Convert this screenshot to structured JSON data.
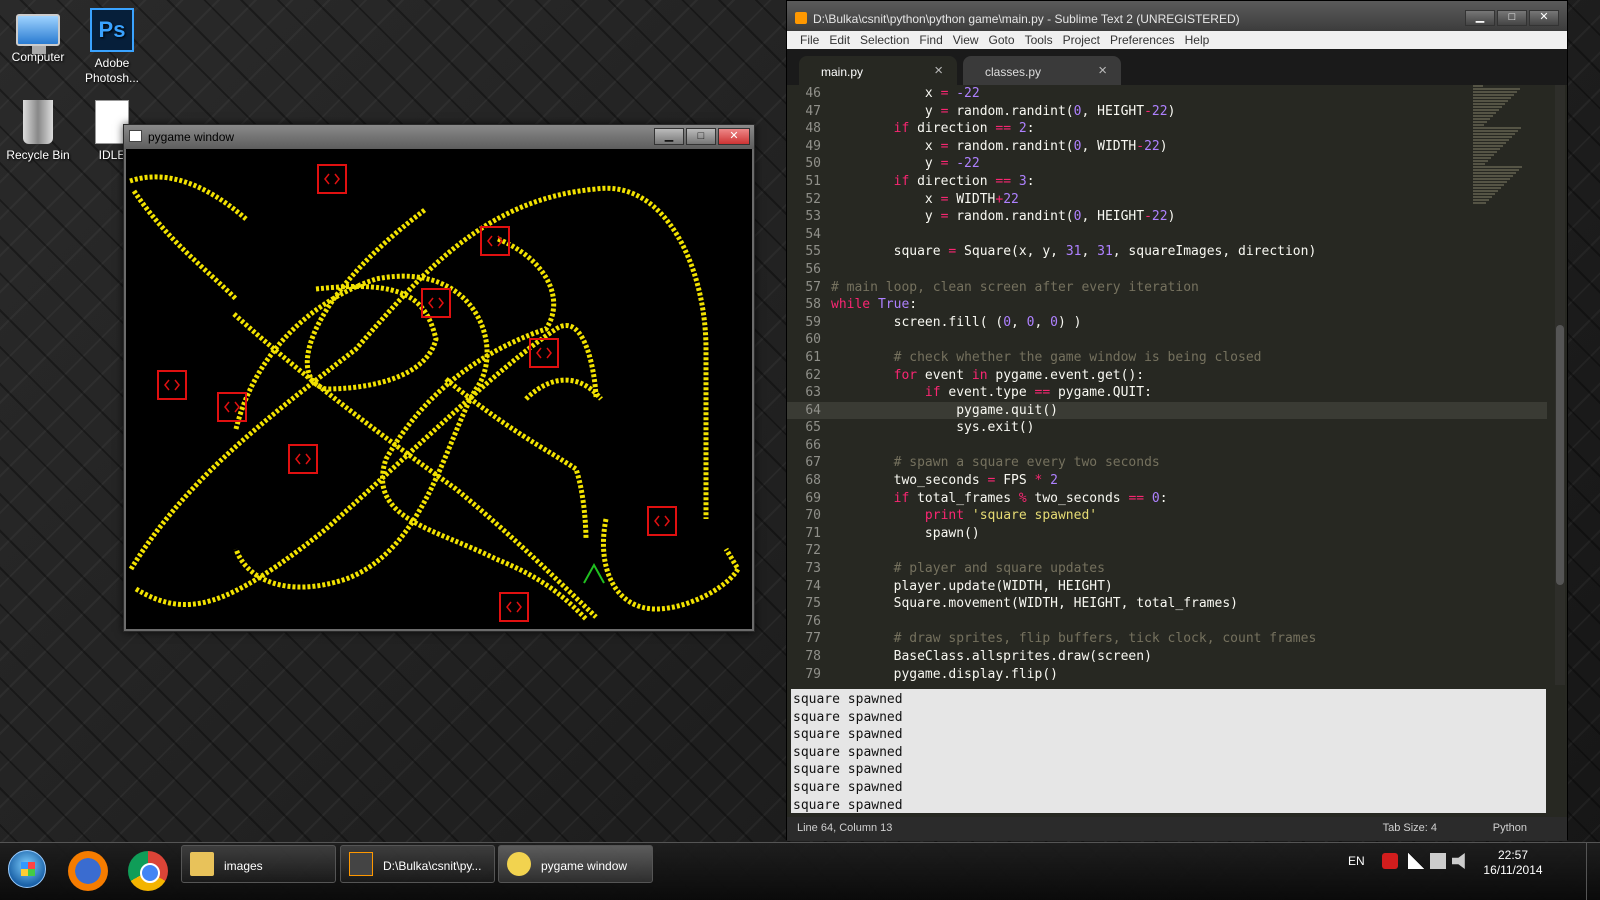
{
  "desktop_icons": [
    {
      "name": "computer",
      "label": "Computer"
    },
    {
      "name": "photoshop",
      "label": "Adobe Photosh..."
    },
    {
      "name": "recycle-bin",
      "label": "Recycle Bin"
    },
    {
      "name": "idle",
      "label": "IDLE"
    }
  ],
  "pygame_window": {
    "title": "pygame window",
    "buttons": {
      "minimize": "▁",
      "maximize": "□",
      "close": "✕"
    },
    "colors": {
      "background": "#000000",
      "trail": "#f2e200",
      "square": "#e01010",
      "player": "#20c020"
    }
  },
  "sublime": {
    "title": "D:\\Bulka\\csnit\\python\\python game\\main.py - Sublime Text 2 (UNREGISTERED)",
    "buttons": {
      "minimize": "▁",
      "maximize": "□",
      "close": "✕"
    },
    "menu": [
      "File",
      "Edit",
      "Selection",
      "Find",
      "View",
      "Goto",
      "Tools",
      "Project",
      "Preferences",
      "Help"
    ],
    "tabs": [
      {
        "label": "main.py",
        "active": true,
        "close": "×"
      },
      {
        "label": "classes.py",
        "active": false,
        "close": "×"
      }
    ],
    "current_line": 64,
    "code_lines": [
      {
        "n": 46,
        "tokens": [
          [
            "            x ",
            "code"
          ],
          [
            "=",
            "op"
          ],
          [
            " ",
            "code"
          ],
          [
            "-22",
            "num"
          ]
        ]
      },
      {
        "n": 47,
        "tokens": [
          [
            "            y ",
            "code"
          ],
          [
            "=",
            "op"
          ],
          [
            " random.randint(",
            "code"
          ],
          [
            "0",
            "num"
          ],
          [
            ", HEIGHT",
            "code"
          ],
          [
            "-",
            "op"
          ],
          [
            "22",
            "num"
          ],
          [
            ")",
            "code"
          ]
        ]
      },
      {
        "n": 48,
        "tokens": [
          [
            "        ",
            "code"
          ],
          [
            "if",
            "kw"
          ],
          [
            " direction ",
            "code"
          ],
          [
            "==",
            "op"
          ],
          [
            " ",
            "code"
          ],
          [
            "2",
            "num"
          ],
          [
            ":",
            "code"
          ]
        ]
      },
      {
        "n": 49,
        "tokens": [
          [
            "            x ",
            "code"
          ],
          [
            "=",
            "op"
          ],
          [
            " random.randint(",
            "code"
          ],
          [
            "0",
            "num"
          ],
          [
            ", WIDTH",
            "code"
          ],
          [
            "-",
            "op"
          ],
          [
            "22",
            "num"
          ],
          [
            ")",
            "code"
          ]
        ]
      },
      {
        "n": 50,
        "tokens": [
          [
            "            y ",
            "code"
          ],
          [
            "=",
            "op"
          ],
          [
            " ",
            "code"
          ],
          [
            "-22",
            "num"
          ]
        ]
      },
      {
        "n": 51,
        "tokens": [
          [
            "        ",
            "code"
          ],
          [
            "if",
            "kw"
          ],
          [
            " direction ",
            "code"
          ],
          [
            "==",
            "op"
          ],
          [
            " ",
            "code"
          ],
          [
            "3",
            "num"
          ],
          [
            ":",
            "code"
          ]
        ]
      },
      {
        "n": 52,
        "tokens": [
          [
            "            x ",
            "code"
          ],
          [
            "=",
            "op"
          ],
          [
            " WIDTH",
            "code"
          ],
          [
            "+",
            "op"
          ],
          [
            "22",
            "num"
          ]
        ]
      },
      {
        "n": 53,
        "tokens": [
          [
            "            y ",
            "code"
          ],
          [
            "=",
            "op"
          ],
          [
            " random.randint(",
            "code"
          ],
          [
            "0",
            "num"
          ],
          [
            ", HEIGHT",
            "code"
          ],
          [
            "-",
            "op"
          ],
          [
            "22",
            "num"
          ],
          [
            ")",
            "code"
          ]
        ]
      },
      {
        "n": 54,
        "tokens": []
      },
      {
        "n": 55,
        "tokens": [
          [
            "        square ",
            "code"
          ],
          [
            "=",
            "op"
          ],
          [
            " Square(x, y, ",
            "code"
          ],
          [
            "31",
            "num"
          ],
          [
            ", ",
            "code"
          ],
          [
            "31",
            "num"
          ],
          [
            ", squareImages, direction)",
            "code"
          ]
        ]
      },
      {
        "n": 56,
        "tokens": []
      },
      {
        "n": 57,
        "tokens": [
          [
            "# main loop, clean screen after every iteration",
            "cmt"
          ]
        ]
      },
      {
        "n": 58,
        "tokens": [
          [
            "while",
            "kw"
          ],
          [
            " ",
            "code"
          ],
          [
            "True",
            "num"
          ],
          [
            ":",
            "code"
          ]
        ]
      },
      {
        "n": 59,
        "tokens": [
          [
            "        screen.fill( (",
            "code"
          ],
          [
            "0",
            "num"
          ],
          [
            ", ",
            "code"
          ],
          [
            "0",
            "num"
          ],
          [
            ", ",
            "code"
          ],
          [
            "0",
            "num"
          ],
          [
            ") )",
            "code"
          ]
        ]
      },
      {
        "n": 60,
        "tokens": []
      },
      {
        "n": 61,
        "tokens": [
          [
            "        ",
            "code"
          ],
          [
            "# check whether the game window is being closed",
            "cmt"
          ]
        ]
      },
      {
        "n": 62,
        "tokens": [
          [
            "        ",
            "code"
          ],
          [
            "for",
            "kw"
          ],
          [
            " event ",
            "code"
          ],
          [
            "in",
            "kw"
          ],
          [
            " pygame.event.get():",
            "code"
          ]
        ]
      },
      {
        "n": 63,
        "tokens": [
          [
            "            ",
            "code"
          ],
          [
            "if",
            "kw"
          ],
          [
            " event.type ",
            "code"
          ],
          [
            "==",
            "op"
          ],
          [
            " pygame.QUIT:",
            "code"
          ]
        ]
      },
      {
        "n": 64,
        "tokens": [
          [
            "                pygame.quit()",
            "code"
          ]
        ]
      },
      {
        "n": 65,
        "tokens": [
          [
            "                sys.exit()",
            "code"
          ]
        ]
      },
      {
        "n": 66,
        "tokens": []
      },
      {
        "n": 67,
        "tokens": [
          [
            "        ",
            "code"
          ],
          [
            "# spawn a square every two seconds",
            "cmt"
          ]
        ]
      },
      {
        "n": 68,
        "tokens": [
          [
            "        two_seconds ",
            "code"
          ],
          [
            "=",
            "op"
          ],
          [
            " FPS ",
            "code"
          ],
          [
            "*",
            "op"
          ],
          [
            " ",
            "code"
          ],
          [
            "2",
            "num"
          ]
        ]
      },
      {
        "n": 69,
        "tokens": [
          [
            "        ",
            "code"
          ],
          [
            "if",
            "kw"
          ],
          [
            " total_frames ",
            "code"
          ],
          [
            "%",
            "op"
          ],
          [
            " two_seconds ",
            "code"
          ],
          [
            "==",
            "op"
          ],
          [
            " ",
            "code"
          ],
          [
            "0",
            "num"
          ],
          [
            ":",
            "code"
          ]
        ]
      },
      {
        "n": 70,
        "tokens": [
          [
            "            ",
            "code"
          ],
          [
            "print",
            "kw"
          ],
          [
            " ",
            "code"
          ],
          [
            "'square spawned'",
            "str"
          ]
        ]
      },
      {
        "n": 71,
        "tokens": [
          [
            "            spawn()",
            "code"
          ]
        ]
      },
      {
        "n": 72,
        "tokens": []
      },
      {
        "n": 73,
        "tokens": [
          [
            "        ",
            "code"
          ],
          [
            "# player and square updates",
            "cmt"
          ]
        ]
      },
      {
        "n": 74,
        "tokens": [
          [
            "        player.update(WIDTH, HEIGHT)",
            "code"
          ]
        ]
      },
      {
        "n": 75,
        "tokens": [
          [
            "        Square.movement(WIDTH, HEIGHT, total_frames)",
            "code"
          ]
        ]
      },
      {
        "n": 76,
        "tokens": []
      },
      {
        "n": 77,
        "tokens": [
          [
            "        ",
            "code"
          ],
          [
            "# draw sprites, flip buffers, tick clock, count frames",
            "cmt"
          ]
        ]
      },
      {
        "n": 78,
        "tokens": [
          [
            "        BaseClass.allsprites.draw(screen)",
            "code"
          ]
        ]
      },
      {
        "n": 79,
        "tokens": [
          [
            "        pygame.display.flip()",
            "code"
          ]
        ]
      }
    ],
    "console_lines": [
      "square spawned",
      "square spawned",
      "square spawned",
      "square spawned",
      "square spawned",
      "square spawned",
      "square spawned"
    ],
    "status": {
      "position": "Line 64, Column 13",
      "tab_size": "Tab Size: 4",
      "syntax": "Python"
    }
  },
  "taskbar": {
    "pinned": [
      "firefox",
      "chrome"
    ],
    "tasks": [
      {
        "label": "images",
        "icon": "folder-icon"
      },
      {
        "label": "D:\\Bulka\\csnit\\py...",
        "icon": "sublime-icon"
      },
      {
        "label": "pygame window",
        "icon": "pygame-icon"
      }
    ],
    "tray": {
      "language": "EN"
    },
    "clock": {
      "time": "22:57",
      "date": "16/11/2014"
    }
  }
}
